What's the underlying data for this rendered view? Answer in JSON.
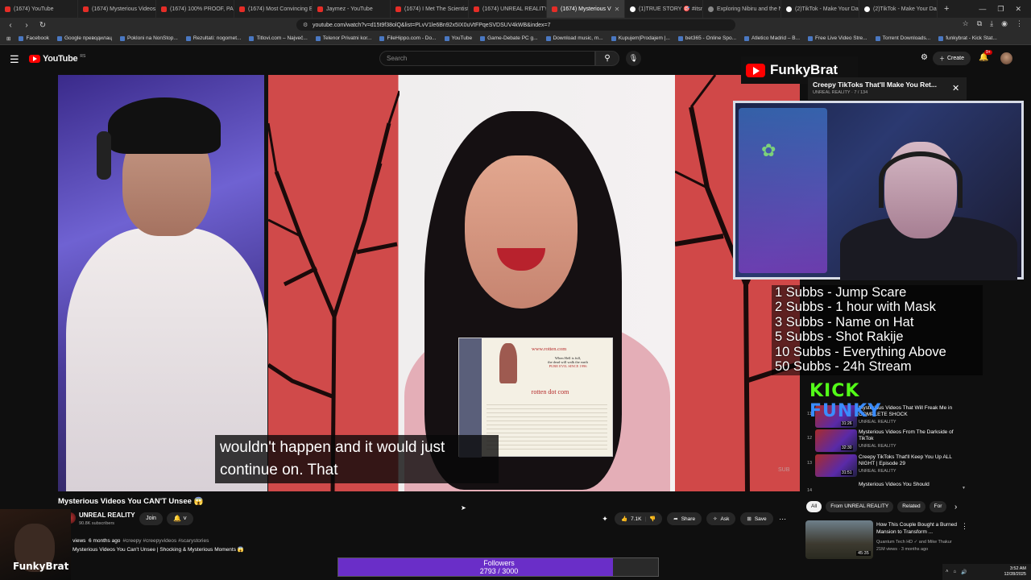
{
  "browser": {
    "tabs": [
      {
        "label": "(1674) YouTube",
        "kind": "yt"
      },
      {
        "label": "(1674) Mysterious Videos N",
        "kind": "yt"
      },
      {
        "label": "(1674) 100% PROOF, PARA",
        "kind": "yt"
      },
      {
        "label": "(1674) Most Convincing Ev",
        "kind": "yt"
      },
      {
        "label": "Jaymez - YouTube",
        "kind": "yt"
      },
      {
        "label": "(1674) I Met The Scientist T",
        "kind": "yt"
      },
      {
        "label": "(1674) UNREAL REALITY",
        "kind": "yt"
      },
      {
        "label": "(1674) Mysterious V",
        "kind": "yt",
        "active": true
      },
      {
        "label": "(1)TRUE STORY 🎯 #itsnotr",
        "kind": "tt"
      },
      {
        "label": "Exploring Nibiru and the N",
        "kind": "gen"
      },
      {
        "label": "(2)TikTok - Make Your Day",
        "kind": "tt"
      },
      {
        "label": "(2)TikTok - Make Your Day",
        "kind": "tt"
      }
    ],
    "url": "youtube.com/watch?v=d15t9f38olQ&list=PLvV1le6Bn92x5IX0uVtFPqeSVDSUV4kWB&index=7",
    "bookmarks": [
      "Facebook",
      "Google преводилац",
      "Pokloni na NonStop...",
      "Rezultati: nogomet...",
      "Titlovi.com – Največ...",
      "Telenor Privatni kor...",
      "FileHippo.com - Do...",
      "YouTube",
      "Game-Debate PC g...",
      "Download music, m...",
      "Kupujem|Prodajem |...",
      "bet365 - Online Spo...",
      "Atletico Madrid – B...",
      "Free Live Video Stre...",
      "Torrent Downloads...",
      "funkybrat - Kick Stat..."
    ]
  },
  "youtube": {
    "logo_word": "YouTube",
    "region": "RS",
    "search_placeholder": "Search",
    "create_label": "Create",
    "notif_count": "9+"
  },
  "video": {
    "caption_line1": "wouldn't happen and it would just",
    "caption_line2": "continue on. That",
    "rotten_url": "www.rotten.com",
    "rotten_tag1": "When Hell is full,",
    "rotten_tag2": "the dead will walk the earth",
    "rotten_tag3": "PURE EVIL SINCE 1996",
    "rotten_brand": "rotten dot com",
    "sub_watermark": "SUB",
    "title": "Mysterious Videos You CAN'T Unsee 😱",
    "channel": "UNREAL REALITY",
    "subs": "90.8K subscribers",
    "join_label": "Join",
    "likes": "7.1K",
    "share_label": "Share",
    "ask_label": "Ask",
    "save_label": "Save",
    "views_prefix": "K views",
    "desc_meta": "6 months ago",
    "desc_tags": "#creepy #creepyvideos #scarystories",
    "desc_line2": "Mysterious Videos You Can't Unsee | Shocking & Mysterious Moments 😱"
  },
  "overlay": {
    "channel_name": "FunkyBrat",
    "mini_title": "Creepy TikToks That'll Make You Ret...",
    "mini_sub": "UNREAL REALITY · 7 / 134",
    "goals": [
      "1 Subbs - Jump Scare",
      "2 Subbs - 1 hour with Mask",
      "3 Subbs - Name on Hat",
      "5 Subbs - Shot Rakije",
      "10 Subbs - Everything Above",
      "50 Subbs - 24h Stream"
    ],
    "kick_text": "KICK",
    "kick_text2": "FUNKY",
    "followers_label": "Followers",
    "followers_count": "2793 / 3000",
    "followers_progress": 0.931,
    "cam_text": "FunkyBrat"
  },
  "sidebar": {
    "items": [
      {
        "num": "11",
        "title": "Mysterious Videos That Will Freak Me in COMPLETE SHOCK",
        "channel": "UNREAL REALITY",
        "dur": "31:26"
      },
      {
        "num": "12",
        "title": "Mysterious Videos From The Darkside of TikTok",
        "channel": "UNREAL REALITY",
        "dur": "32:30"
      },
      {
        "num": "13",
        "title": "Creepy TikToks That'll Keep You Up ALL NIGHT | Episode 29",
        "channel": "UNREAL REALITY",
        "dur": "31:51"
      },
      {
        "num": "14",
        "title": "Mysterious Videos You Should",
        "channel": "",
        "dur": ""
      }
    ],
    "chips": [
      "All",
      "From UNREAL REALITY",
      "Related",
      "For"
    ],
    "rec": {
      "title": "How This Couple Bought a Burned Mansion to Transform ...",
      "channel": "Quantum Tech HD ✓ and Mike Thakur",
      "meta": "21M views · 3 months ago",
      "dur": "45:35"
    }
  },
  "taskbar": {
    "time": "3:52 AM",
    "date": "12/28/2025"
  }
}
